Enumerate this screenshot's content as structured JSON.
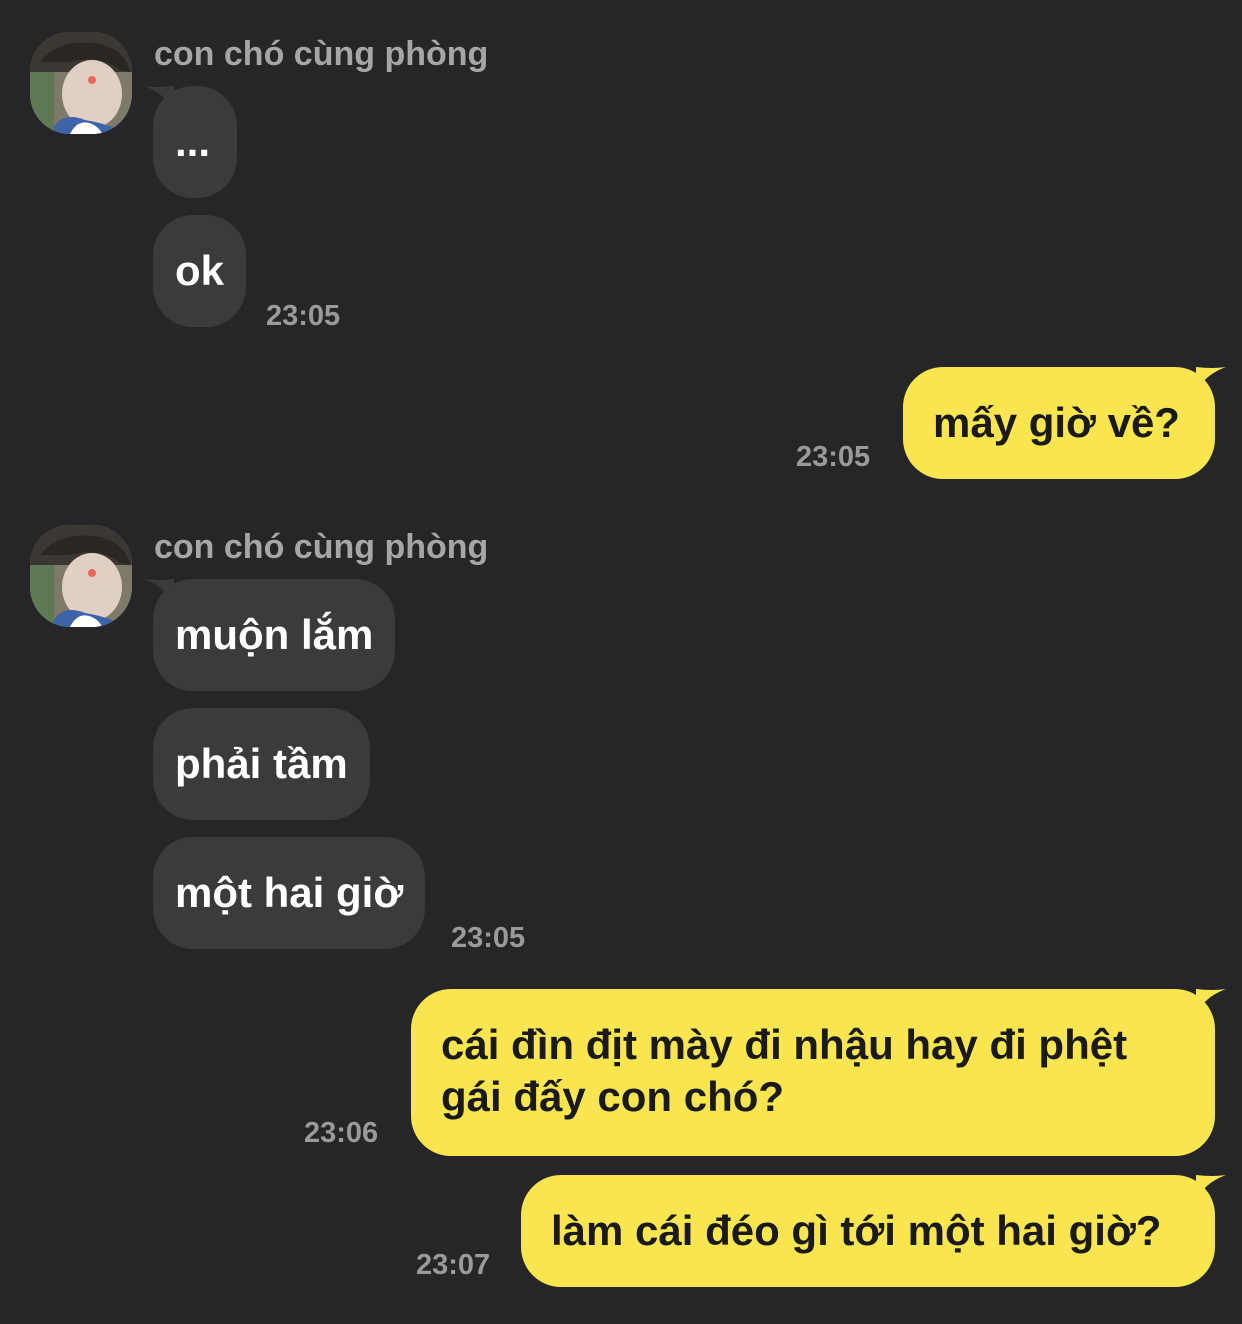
{
  "colors": {
    "background": "#262628",
    "incoming_bubble": "#3b3b3d",
    "outgoing_bubble": "#f9e550",
    "sender_name": "#a6a6a6",
    "timestamp": "#9a9a9a"
  },
  "conversation": {
    "groups": [
      {
        "sender": "con chó cùng phòng",
        "avatar_icon": "profile-photo-avatar",
        "messages": [
          "...",
          "ok"
        ],
        "time": "23:05"
      },
      {
        "outgoing": true,
        "messages": [
          "mấy giờ về?"
        ],
        "time": "23:05"
      },
      {
        "sender": "con chó cùng phòng",
        "avatar_icon": "profile-photo-avatar",
        "messages": [
          "muộn lắm",
          "phải tầm",
          "một hai giờ"
        ],
        "time": "23:05"
      },
      {
        "outgoing": true,
        "messages": [
          "cái đìn địt mày đi nhậu hay đi phệt gái đấy con chó?"
        ],
        "time": "23:06"
      },
      {
        "outgoing": true,
        "messages": [
          "làm cái đéo gì tới một hai giờ?"
        ],
        "time": "23:07"
      }
    ]
  }
}
